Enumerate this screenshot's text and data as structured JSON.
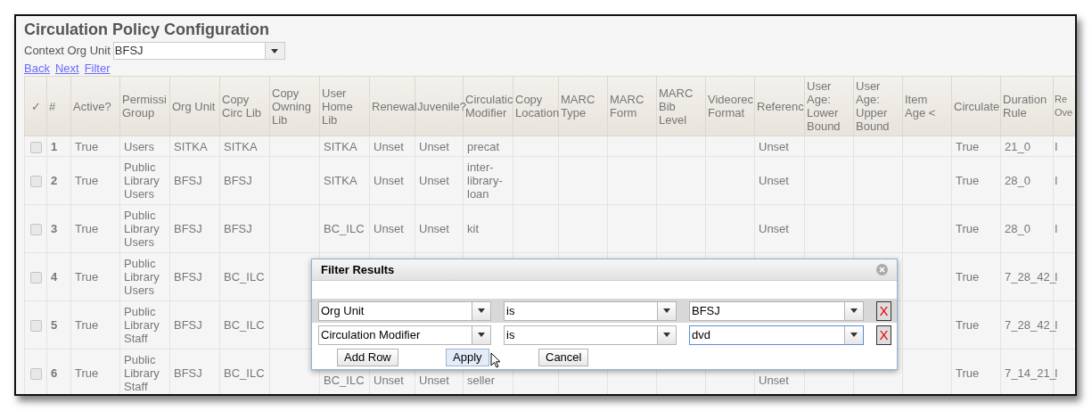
{
  "page": {
    "title": "Circulation Policy Configuration",
    "context_org_unit": {
      "label": "Context Org Unit",
      "value": "BFSJ"
    },
    "links": [
      "Back",
      "Next",
      "Filter"
    ]
  },
  "table": {
    "checkbox_column_header": "✓",
    "columns": [
      {
        "header_lines": [
          "#"
        ]
      },
      {
        "header_lines": [
          "Active?"
        ]
      },
      {
        "header_lines": [
          "Permissi",
          "Group"
        ]
      },
      {
        "header_lines": [
          "Org Unit"
        ]
      },
      {
        "header_lines": [
          "Copy",
          "Circ Lib"
        ]
      },
      {
        "header_lines": [
          "Copy",
          "Owning",
          "Lib"
        ]
      },
      {
        "header_lines": [
          "User",
          "Home",
          "Lib"
        ]
      },
      {
        "header_lines": [
          "Renewal"
        ]
      },
      {
        "header_lines": [
          "Juvenile?"
        ]
      },
      {
        "header_lines": [
          "Circulatic",
          "Modifier"
        ]
      },
      {
        "header_lines": [
          "Copy",
          "Location"
        ]
      },
      {
        "header_lines": [
          "MARC",
          "Type"
        ]
      },
      {
        "header_lines": [
          "MARC",
          "Form"
        ]
      },
      {
        "header_lines": [
          "MARC",
          "Bib",
          "Level"
        ]
      },
      {
        "header_lines": [
          "Videorec",
          "Format"
        ]
      },
      {
        "header_lines": [
          "Referenc"
        ]
      },
      {
        "header_lines": [
          "User",
          "Age:",
          "Lower",
          "Bound"
        ]
      },
      {
        "header_lines": [
          "User",
          "Age:",
          "Upper",
          "Bound"
        ]
      },
      {
        "header_lines": [
          "Item",
          "Age <"
        ]
      },
      {
        "header_lines": [
          "Circulate"
        ]
      },
      {
        "header_lines": [
          "Duration",
          "Rule"
        ]
      },
      {
        "header_lines": [
          "Re",
          "Ove"
        ]
      }
    ],
    "rows": [
      {
        "checked": false,
        "cells": [
          "1",
          "True",
          "Users",
          "SITKA",
          "SITKA",
          null,
          "SITKA",
          "Unset",
          "Unset",
          "precat",
          null,
          null,
          null,
          null,
          null,
          "Unset",
          null,
          null,
          null,
          "True",
          "21_0",
          "I"
        ]
      },
      {
        "checked": false,
        "cells": [
          "2",
          "True",
          "Public Library Users",
          "BFSJ",
          "BFSJ",
          null,
          "SITKA",
          "Unset",
          "Unset",
          "inter-library-loan",
          null,
          null,
          null,
          null,
          null,
          "Unset",
          null,
          null,
          null,
          "True",
          "28_0",
          "I"
        ]
      },
      {
        "checked": false,
        "cells": [
          "3",
          "True",
          "Public Library Users",
          "BFSJ",
          "BFSJ",
          null,
          "BC_ILC",
          "Unset",
          "Unset",
          "kit",
          null,
          null,
          null,
          null,
          null,
          "Unset",
          null,
          null,
          null,
          "True",
          "28_0",
          "I"
        ]
      },
      {
        "checked": false,
        "cells": [
          "4",
          "True",
          "Public Library Users",
          "BFSJ",
          "BC_ILC",
          null,
          null,
          null,
          null,
          null,
          null,
          null,
          null,
          null,
          null,
          null,
          null,
          null,
          null,
          "True",
          "7_28_42_",
          "I"
        ]
      },
      {
        "checked": false,
        "cells": [
          "5",
          "True",
          "Public Library Staff",
          "BFSJ",
          "BC_ILC",
          null,
          null,
          null,
          null,
          null,
          null,
          null,
          null,
          null,
          null,
          null,
          null,
          null,
          null,
          "True",
          "7_28_42_",
          "I"
        ]
      },
      {
        "checked": false,
        "cells": [
          "6",
          "True",
          "Public Library Staff",
          "BFSJ",
          "BC_ILC",
          null,
          "BC_ILC",
          "Unset",
          "Unset",
          "seller",
          null,
          null,
          null,
          null,
          null,
          "Unset",
          null,
          null,
          null,
          "True",
          "7_14_21_",
          "I"
        ]
      }
    ]
  },
  "filter_dialog": {
    "title": "Filter Results",
    "rows": [
      {
        "highlighted": true,
        "field": "Org Unit",
        "operator": "is",
        "value": "BFSJ",
        "value_focused": false,
        "remove": "X"
      },
      {
        "highlighted": false,
        "field": "Circulation Modifier",
        "operator": "is",
        "value": "dvd",
        "value_focused": true,
        "remove": "X"
      }
    ],
    "buttons": [
      {
        "label": "Add Row",
        "hovered": false
      },
      {
        "label": "Apply",
        "hovered": true
      },
      {
        "label": "Cancel",
        "hovered": false
      }
    ]
  }
}
